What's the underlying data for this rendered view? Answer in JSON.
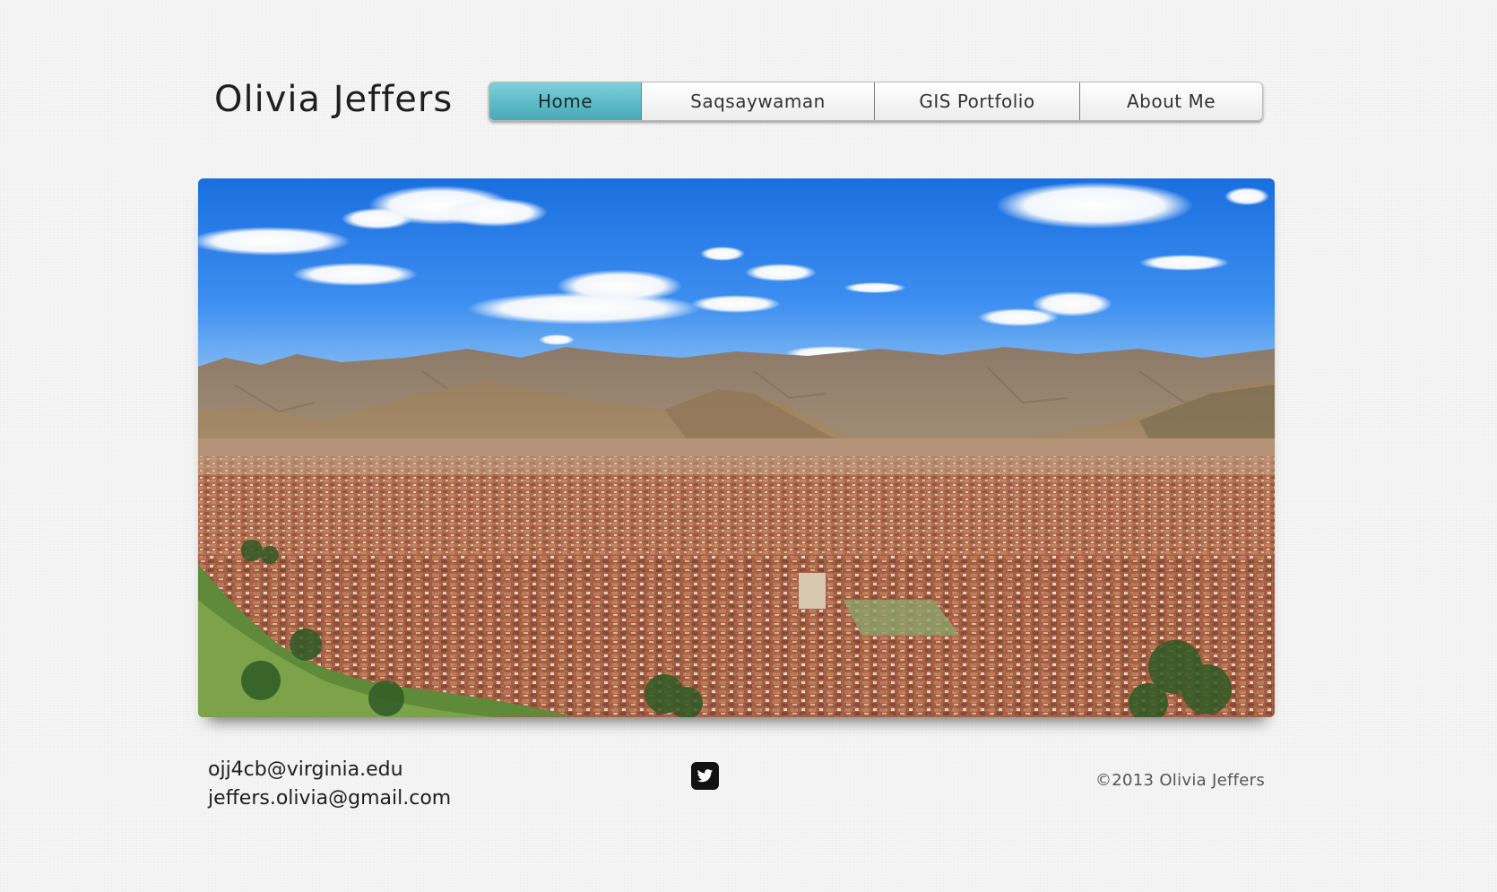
{
  "site": {
    "title": "Olivia Jeffers"
  },
  "nav": {
    "items": [
      {
        "label": "Home",
        "active": true
      },
      {
        "label": "Saqsaywaman",
        "active": false
      },
      {
        "label": "GIS Portfolio",
        "active": false
      },
      {
        "label": "About Me",
        "active": false
      }
    ],
    "accent_color": "#5fbdc8"
  },
  "hero": {
    "icon": "cusco-panorama-photo"
  },
  "footer": {
    "emails": [
      "ojj4cb@virginia.edu",
      "jeffers.olivia@gmail.com"
    ],
    "social_icon": "twitter-icon",
    "copyright": "©2013 Olivia Jeffers"
  }
}
